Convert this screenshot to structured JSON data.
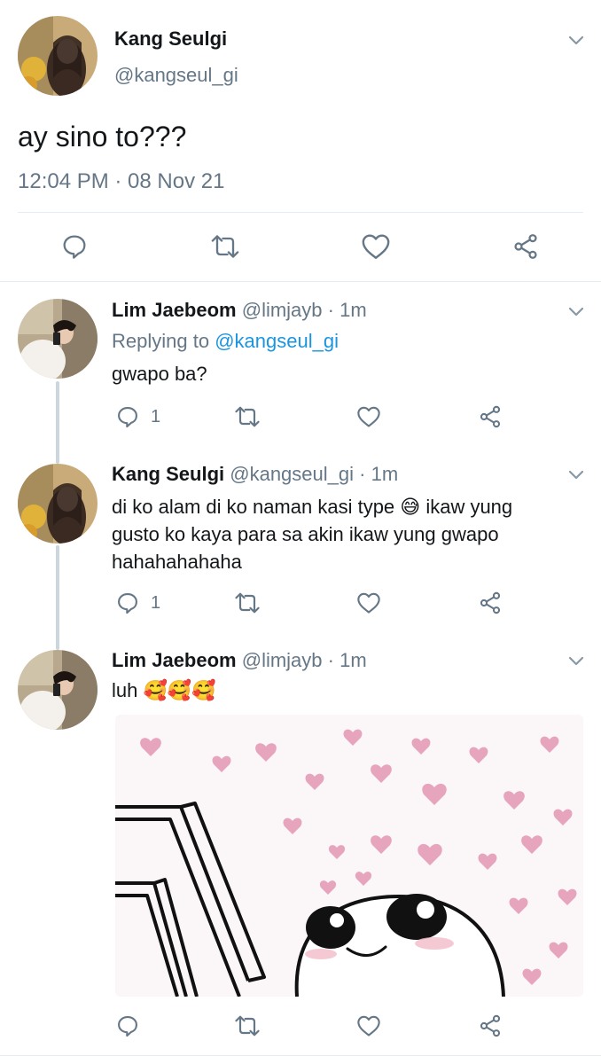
{
  "main_tweet": {
    "display_name": "Kang Seulgi",
    "handle": "@kangseul_gi",
    "text": "ay sino to???",
    "timestamp": "12:04 PM · 08 Nov 21"
  },
  "replies": [
    {
      "display_name": "Lim Jaebeom",
      "handle": "@limjayb",
      "time": "· 1m",
      "replying_prefix": "Replying to",
      "replying_to": "@kangseul_gi",
      "text": "gwapo ba?",
      "reply_count": "1"
    },
    {
      "display_name": "Kang Seulgi",
      "handle": "@kangseul_gi",
      "time": "· 1m",
      "text_line1": "di ko alam di ko naman kasi type 😅 ikaw yung",
      "text_line2": "gusto ko kaya para sa akin ikaw yung gwapo",
      "text_line3": "hahahahahaha",
      "reply_count": "1"
    },
    {
      "display_name": "Lim Jaebeom",
      "handle": "@limjayb",
      "time": "· 1m",
      "text": "luh 🥰🥰🥰",
      "reply_count": ""
    }
  ],
  "icons": [
    "reply-icon",
    "retweet-icon",
    "like-icon",
    "share-icon",
    "chevron-down-icon"
  ],
  "colors": {
    "link": "#1b95e0",
    "muted": "#657786",
    "divider": "#e6ecf0",
    "heart_pink": "#e7a4bd"
  }
}
